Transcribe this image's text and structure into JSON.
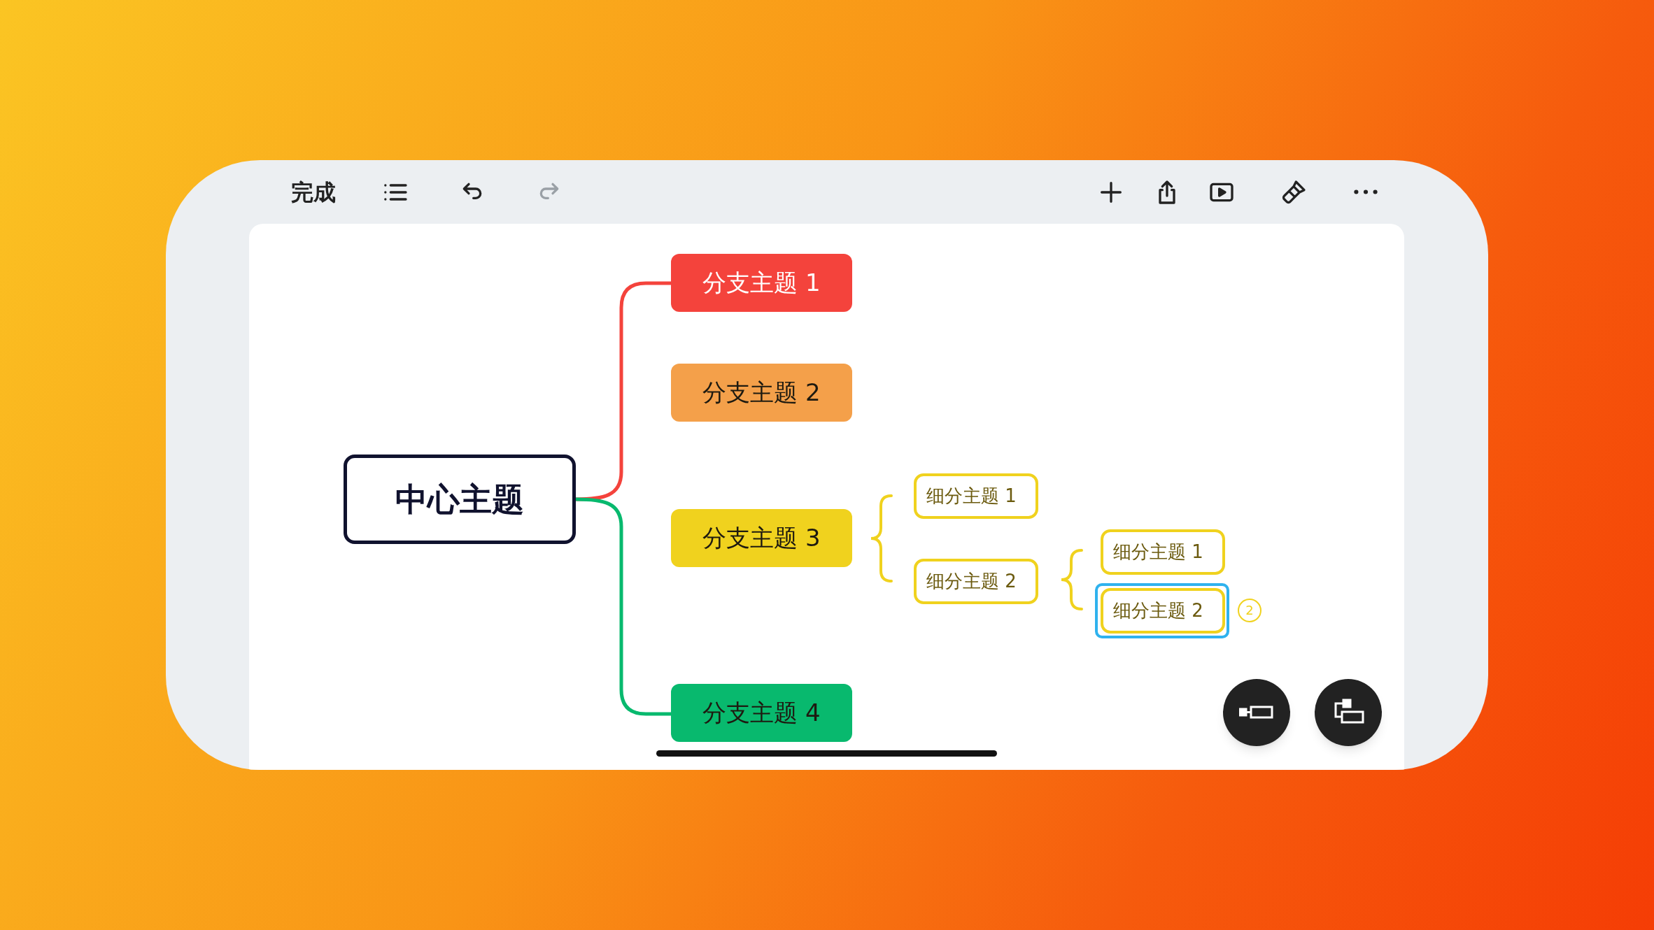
{
  "toolbar": {
    "done": "完成",
    "undo": {
      "disabled": false
    },
    "redo": {
      "disabled": true
    }
  },
  "mindmap": {
    "central": "中心主题",
    "branches": [
      {
        "label": "分支主题 1",
        "color": "#f4433c",
        "selected": false
      },
      {
        "label": "分支主题 2",
        "color": "#f4a04a",
        "selected": false
      },
      {
        "label": "分支主题 3",
        "color": "#f0d21e",
        "selected": false,
        "children": [
          {
            "label": "细分主题 1",
            "selected": false
          },
          {
            "label": "细分主题 2",
            "selected": false,
            "children": [
              {
                "label": "细分主题 1",
                "selected": false
              },
              {
                "label": "细分主题 2",
                "selected": true,
                "badge": "2"
              }
            ]
          }
        ]
      },
      {
        "label": "分支主题 4",
        "color": "#08b96e",
        "selected": false
      }
    ]
  }
}
